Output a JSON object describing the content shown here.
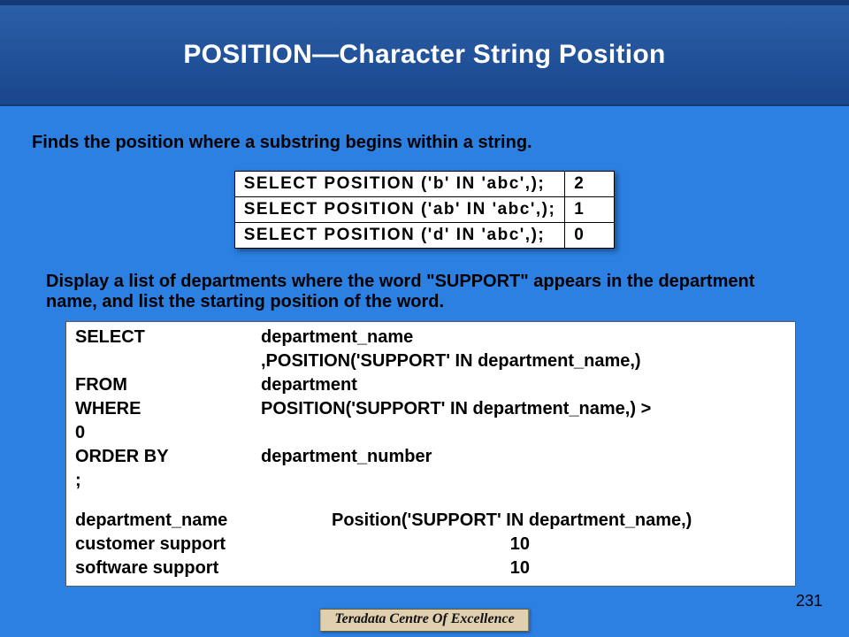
{
  "title": "POSITION—Character String Position",
  "subtitle": "Finds the position where a substring begins within a string.",
  "examples": [
    {
      "stmt": "SELECT  POSITION ('b' IN 'abc',);",
      "result": "2"
    },
    {
      "stmt": "SELECT  POSITION ('ab' IN 'abc',);",
      "result": "1"
    },
    {
      "stmt": "SELECT  POSITION ('d' IN 'abc',);",
      "result": "0"
    }
  ],
  "instruction": "Display a list of departments where the word \"SUPPORT\" appears in the department name, and list the starting position of the word.",
  "query": {
    "select_kw": "SELECT",
    "select_arg": "department_name",
    "select_arg2": ",POSITION('SUPPORT' IN department_name,)",
    "from_kw": "FROM",
    "from_arg": "department",
    "where_kw": "WHERE",
    "where_arg": "POSITION('SUPPORT' IN department_name,) >",
    "zero": "0",
    "order_kw": "ORDER BY",
    "order_arg": "department_number",
    "semi": ";"
  },
  "result_header": {
    "col1": "department_name",
    "col2": "Position('SUPPORT' IN department_name,)"
  },
  "results": [
    {
      "name": "customer support",
      "pos": "10"
    },
    {
      "name": "software support",
      "pos": "10"
    }
  ],
  "page_number": "231",
  "footer": "Teradata Centre Of Excellence"
}
